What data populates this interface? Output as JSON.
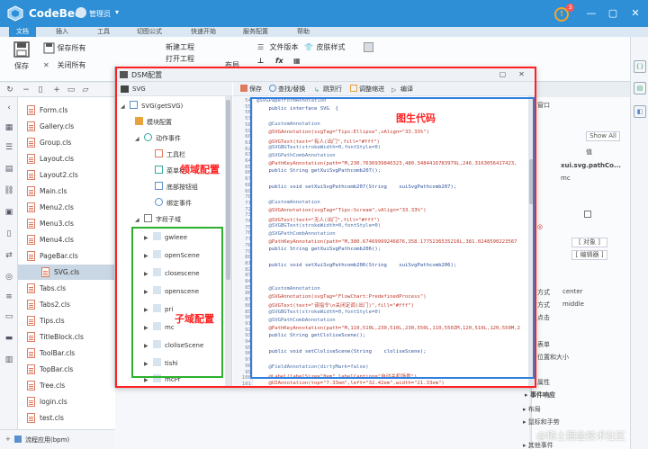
{
  "app": {
    "name": "CodeBee",
    "user": "管理员",
    "notification_count": "3"
  },
  "window": {
    "min": "—",
    "max": "▢",
    "close": "✕"
  },
  "ribbon_tabs": [
    "文档",
    "插入",
    "工具",
    "切图公式",
    "快速开始",
    "服务配置",
    "帮助"
  ],
  "ribbon": {
    "save": "保存",
    "save_all": "保存所有",
    "close_all": "关闭所有",
    "new_project": "新建工程",
    "open_project": "打开工程",
    "file_version": "文件版本",
    "skin_style": "皮肤样式",
    "layout": "布局",
    "fx": "fx"
  },
  "files": [
    "Form.cls",
    "Gallery.cls",
    "Group.cls",
    "Layout.cls",
    "Layout2.cls",
    "Main.cls",
    "Menu2.cls",
    "Menu3.cls",
    "Menu4.cls",
    "PageBar.cls",
    "SVG.cls",
    "Tabs.cls",
    "Tabs2.cls",
    "Tips.cls",
    "TitleBlock.cls",
    "ToolBar.cls",
    "TopBar.cls",
    "Tree.cls",
    "login.cls",
    "test.cls"
  ],
  "selected_file": "SVG.cls",
  "bottom_bar": {
    "label": "流程应用(bpm)"
  },
  "props": {
    "value_header": "值",
    "show_all": "Show All",
    "row1_value": "xui.svg.pathCo...",
    "row2_value": "mc",
    "btn_object": "[ 对象 ]",
    "btn_edit": "[ 编辑器 ]",
    "align_label": "方式",
    "align_value": "center",
    "valign_label": "方式",
    "valign_value": "middle",
    "tip_event": "点击",
    "list_label": "表单",
    "position_label": "位置和大小",
    "attr_label": "属性",
    "events_header": "事件响应",
    "ev_layout": "布局",
    "ev_mouse": "鼠标和手势",
    "ev_other": "其他事件"
  },
  "dialog": {
    "title": "DSM配置",
    "tree_root": "SVG",
    "tree": {
      "svg_get": "SVG(getSVG)",
      "module_config": "模块配置",
      "action_events": "动作事件",
      "toolbar": "工具栏",
      "menubar": "菜单栏",
      "bottom_buttons": "底部按钮组",
      "bind_events": "绑定事件",
      "field_sub": "字段子域",
      "subs": [
        "gwleee",
        "openScene",
        "closescene",
        "openscene",
        "pri",
        "mc",
        "cloliseScene",
        "tishi",
        "mcPr"
      ]
    },
    "code_toolbar": [
      "保存",
      "查找/替换",
      "跳到行",
      "调整缩进",
      "编译"
    ],
    "line_numbers": [
      "54",
      "55",
      "56",
      "57",
      "58",
      "59",
      "60",
      "61",
      "62",
      "63",
      "64",
      "65",
      "66",
      "67",
      "68",
      "69",
      "70",
      "71",
      "72",
      "73",
      "74",
      "75",
      "76",
      "77",
      "78",
      "79",
      "80",
      "81",
      "82",
      "83",
      "84",
      "85",
      "86",
      "87",
      "88",
      "89",
      "90",
      "91",
      "92",
      "93",
      "94",
      "95",
      "96",
      "97",
      "98",
      "99",
      "100",
      "101"
    ],
    "code_lines": [
      {
        "t": "@SVGPaperFormAnnotation",
        "c": "anno"
      },
      {
        "t": "    public interface SVG  {",
        "c": "kw"
      },
      {
        "t": "",
        "c": "plain"
      },
      {
        "t": "    @CustomAnnotation",
        "c": "anno"
      },
      {
        "t": "    @SVGAnnotation(svgTag=\"Tips:Ellipse\",vAlign=\"33.33%\")",
        "c": "str"
      },
      {
        "t": "    @SVGText(text=\"有人(出门\",fill=\"#fff\")",
        "c": "str"
      },
      {
        "t": "    @SVGBGText(strokeWidth=0,fontStyle=0)",
        "c": "anno"
      },
      {
        "t": "    @SVGPathCombAnnotation",
        "c": "anno"
      },
      {
        "t": "    @PathKeyAnnotation(path=\"M,230.7636939846323,480.3484416783979L,246.3163056417423,",
        "c": "str"
      },
      {
        "t": "    public String getXuiSvgPathcomb207();",
        "c": "kw"
      },
      {
        "t": "",
        "c": "plain"
      },
      {
        "t": "    public void setXuiSvgPathcomb207(String    xuiSvgPathcomb207);",
        "c": "kw"
      },
      {
        "t": "",
        "c": "plain"
      },
      {
        "t": "    @CustomAnnotation",
        "c": "anno"
      },
      {
        "t": "    @SVGAnnotation(svgTag=\"Tips:Scream\",vAlign=\"33.33%\")",
        "c": "str"
      },
      {
        "t": "    @SVGText(text=\"无人(出门\",fill=\"#fff\")",
        "c": "str"
      },
      {
        "t": "    @SVGBGText(strokeWidth=0,fontStyle=0)",
        "c": "anno"
      },
      {
        "t": "    @SVGPathCombAnnotation",
        "c": "anno"
      },
      {
        "t": "    @PathKeyAnnotation(path=\"M,380.67469999246876,358.1775236535216L,381.0248590223567",
        "c": "str"
      },
      {
        "t": "    public String getXuiSvgPathcomb206();",
        "c": "kw"
      },
      {
        "t": "",
        "c": "plain"
      },
      {
        "t": "    public void setXuiSvgPathcomb206(String    xuiSvgPathcomb206);",
        "c": "kw"
      },
      {
        "t": "",
        "c": "plain"
      },
      {
        "t": "",
        "c": "plain"
      },
      {
        "t": "    @CustomAnnotation",
        "c": "anno"
      },
      {
        "t": "    @SVGAnnotation(svgTag=\"FlowChart:PredefinedProcess\")",
        "c": "str"
      },
      {
        "t": "    @SVGText(text=\"该指令\\n关闭定调(出门)\",fill=\"#fff\")",
        "c": "str"
      },
      {
        "t": "    @SVGBGText(strokeWidth=0,fontStyle=0)",
        "c": "anno"
      },
      {
        "t": "    @SVGPathCombAnnotation",
        "c": "anno"
      },
      {
        "t": "    @PathKeyAnnotation(path=\"M,110,510L,230,510L,230,550L,110,550ZM,120,510L,120,550M,2",
        "c": "str"
      },
      {
        "t": "    public String getCloliseScene();",
        "c": "kw"
      },
      {
        "t": "",
        "c": "plain"
      },
      {
        "t": "    public void setCloliseScene(String    cloliseScene);",
        "c": "kw"
      },
      {
        "t": "",
        "c": "plain"
      },
      {
        "t": "    @FieldAnnotation(dirtyMark=false)",
        "c": "anno"
      },
      {
        "t": "    @Label(labelSize=\"8em\",labelCaption=\"自动关机场景\")",
        "c": "str"
      },
      {
        "t": "    @UIAnnotation(top=\"7.33em\",left=\"32.42em\",width=\"21.33em\")",
        "c": "str"
      }
    ]
  },
  "annotations": {
    "field_config": "领域配置",
    "sub_config": "子域配置",
    "gen_code": "图生代码"
  },
  "watermark": "@稀土掘金技术社区",
  "colors": {
    "accent": "#2f8fd6",
    "red_frame": "#ff2020",
    "blue_frame": "#2f7fe0",
    "green_frame": "#2db02d"
  }
}
